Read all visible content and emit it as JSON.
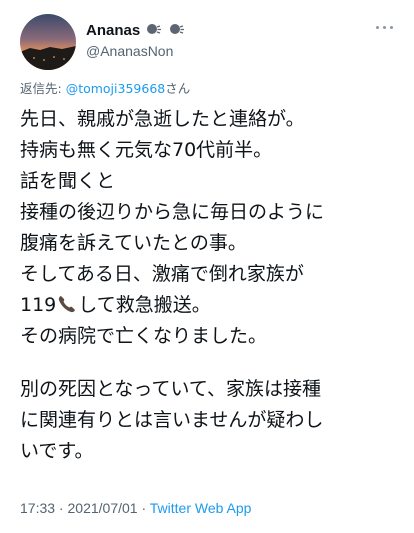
{
  "user": {
    "display_name": "Ananas",
    "handle": "@AnanasNon",
    "name_emoji": [
      "speaking-head-icon",
      "speaking-head-icon"
    ]
  },
  "reply": {
    "prefix": "返信先: ",
    "target": "@tomoji359668",
    "suffix": "さん"
  },
  "tweet": {
    "line1": "先日、親戚が急逝したと連絡が。",
    "line2": "持病も無く元気な70代前半。",
    "line3": "話を聞くと",
    "line4": "接種の後辺りから急に毎日のように",
    "line5": "腹痛を訴えていたとの事。",
    "line6": "そしてある日、激痛で倒れ家族が",
    "line7_pre": "119",
    "line7_icon": "telephone-receiver-icon",
    "line7_post": "して救急搬送。",
    "line8": "その病院で亡くなりました。",
    "para2": "別の死因となっていて、家族は接種\nに関連有りとは言いませんが疑わし\nいです。"
  },
  "meta": {
    "time": "17:33",
    "sep": " · ",
    "date": "2021/07/01",
    "sep2": " · ",
    "source": "Twitter Web App"
  },
  "colors": {
    "link": "#1d9bf0",
    "secondary": "#536471",
    "text": "#0f1419"
  }
}
